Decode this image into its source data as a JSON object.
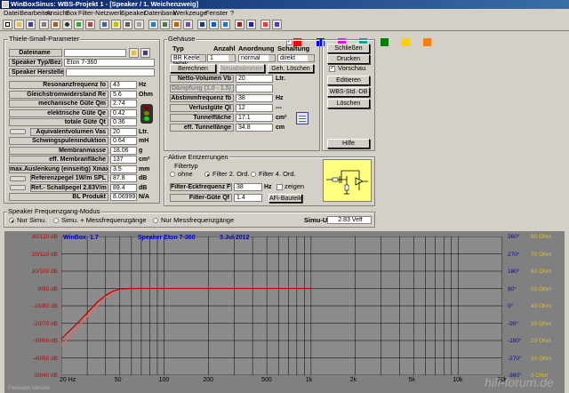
{
  "window": {
    "title": "WinBoxSinus: WBS-Projekt 1 - [Speaker / 1. Weichenzweig]"
  },
  "menu": [
    "Datei",
    "Bearbeiten",
    "Ansicht",
    "Box",
    "Filter-Netzwerk",
    "Speaker",
    "Datenbank",
    "Werkzeuge",
    "Fenster",
    "?"
  ],
  "tsp": {
    "title": "Thiele-Small-Parameter",
    "dateiname_label": "Dateiname",
    "dateiname_value": "",
    "typ_label": "Speaker Typ/Bez.",
    "typ_value": "Eton 7-360",
    "hersteller_label": "Speaker Hersteller",
    "hersteller_value": "",
    "rows": [
      {
        "label": "Resonanzfrequenz fo",
        "value": "43",
        "unit": "Hz"
      },
      {
        "label": "Gleichstromwiderstand Re",
        "value": "5.6",
        "unit": "Ohm"
      },
      {
        "label": "mechanische Güte Qm",
        "value": "2.74",
        "unit": ""
      },
      {
        "label": "elektrische Güte Qe",
        "value": "0.42",
        "unit": ""
      },
      {
        "label": "totale Güte Qt",
        "value": "0.36",
        "unit": ""
      },
      {
        "label": "Äquivalentvolumen Vas",
        "value": "20",
        "unit": "Ltr."
      },
      {
        "label": "Schwingspuleninduktion",
        "value": "0.64",
        "unit": "mH"
      },
      {
        "label": "Membranmasse",
        "value": "18.06",
        "unit": "g"
      },
      {
        "label": "eff. Membranfläche",
        "value": "137",
        "unit": "cm²"
      },
      {
        "label": "max.Auslenkung (einseitig) Xmax.",
        "value": "3.5",
        "unit": "mm"
      },
      {
        "label": "Referenzpegel 1W/m SPL",
        "value": "87.8",
        "unit": "dB"
      },
      {
        "label": "Ref.- Schallpegel 2.83V/m",
        "value": "89.4",
        "unit": "dB"
      },
      {
        "label": "BL Produkt",
        "value": "8.06999",
        "unit": "N/A"
      }
    ]
  },
  "gehaeuse": {
    "title": "Gehäuse",
    "h_typ": "Typ",
    "h_anzahl": "Anzahl",
    "h_anordnung": "Anordnung",
    "h_schaltung": "Schaltung",
    "typ": "BR Keele teilak",
    "anzahl": "1",
    "anordnung": "normal",
    "schaltung": "direkt",
    "btn_berechnen": "Berechnen",
    "btn_neuabstimmen": "Neuabstimmen",
    "btn_loeschen": "Geh. Löschen",
    "rows": [
      {
        "label": "Netto-Volumen Vb",
        "value": "20",
        "unit": "Ltr."
      },
      {
        "label": "Dämpfung (1.0 - 1.5)",
        "value": "",
        "unit": ""
      },
      {
        "label": "Abstimmfrequenz fb",
        "value": "38",
        "unit": "Hz"
      },
      {
        "label": "Verlustgüte Ql",
        "value": "12",
        "unit": "---"
      },
      {
        "label": "Tunnelfläche",
        "value": "17.1",
        "unit": "cm²"
      },
      {
        "label": "eff. Tunnellänge",
        "value": "34.8",
        "unit": "cm"
      }
    ]
  },
  "side": {
    "schliessen": "Schließen",
    "drucken": "Drucken",
    "vorschau": "Vorschau",
    "editieren": "Editieren",
    "wbs_db": "WBS-Std.-DB",
    "loeschen": "Löschen",
    "hilfe": "Hilfe"
  },
  "entzerrung": {
    "title": "Aktive Entzerrungen",
    "filtertyp": "Filtertyp",
    "ohne": "ohne",
    "filter2": "Filter 2. Ord.",
    "filter4": "Filter 4. Ord.",
    "eck_label": "Filter-Eckfrequenz Ff",
    "eck_value": "38",
    "eck_unit": "Hz",
    "zeigen": "zeigen",
    "guete_label": "Filter-Güte Qf",
    "guete_value": "1.4",
    "btn_bauteile": "AFi-Bauteile"
  },
  "modus": {
    "title": "Speaker Frequenzgang-Modus",
    "opt1": "Nur Simu.",
    "opt2": "Simu. + Messfrequenzgänge",
    "opt3": "Nur Messfrequenzgänge",
    "simu_label": "Simu-U",
    "simu_value": "2.83 Veff"
  },
  "chart_data": {
    "type": "line",
    "app_label": "WinBox",
    "version": "1.7",
    "speaker": "Speaker Eton 7-360",
    "date": "3.Jul 2012",
    "x_ticks": [
      "20 Hz",
      "50",
      "100",
      "200",
      "500",
      "1k",
      "2k",
      "5k",
      "10k",
      "20k"
    ],
    "y_left": [
      "30/120 dB",
      "20/110 dB",
      "10/100 dB",
      "0/90 dB",
      "-10/80 dB",
      "-20/70 dB",
      "-30/60 dB",
      "-40/50 dB",
      "-50/40 dB"
    ],
    "y_right_phase": [
      "360°",
      "270°",
      "180°",
      "90°",
      "0°",
      "-90°",
      "-180°",
      "-270°",
      "-360°"
    ],
    "y_right_ohm": [
      "80 Ohm",
      "70 Ohm",
      "60 Ohm",
      "50 Ohm",
      "40 Ohm",
      "30 Ohm",
      "20 Ohm",
      "10 Ohm",
      "0 Ohm"
    ],
    "ylabel": "dB",
    "series": [
      {
        "x": [
          20,
          25,
          30,
          35,
          40,
          45,
          50,
          60,
          80,
          100,
          200,
          500,
          1000
        ],
        "values": [
          -33,
          -24,
          -16,
          -10,
          -5,
          -2,
          -0.5,
          0,
          0,
          0,
          0,
          0,
          0
        ],
        "color": "#ff6060"
      },
      {
        "x": [
          20,
          25,
          30,
          35,
          40,
          45,
          50,
          60,
          80,
          100,
          200,
          500,
          1000
        ],
        "values": [
          -29,
          -21,
          -14,
          -8,
          -4,
          -1.5,
          -0.3,
          0,
          0,
          0,
          0,
          0,
          0
        ],
        "color": "#c00000"
      }
    ],
    "ylim": [
      -50,
      30
    ],
    "xlim": [
      20,
      20000
    ],
    "xscale": "log",
    "grid": true
  },
  "watermark": {
    "left": "Freeware Version",
    "right": "hifi-forum.de"
  }
}
